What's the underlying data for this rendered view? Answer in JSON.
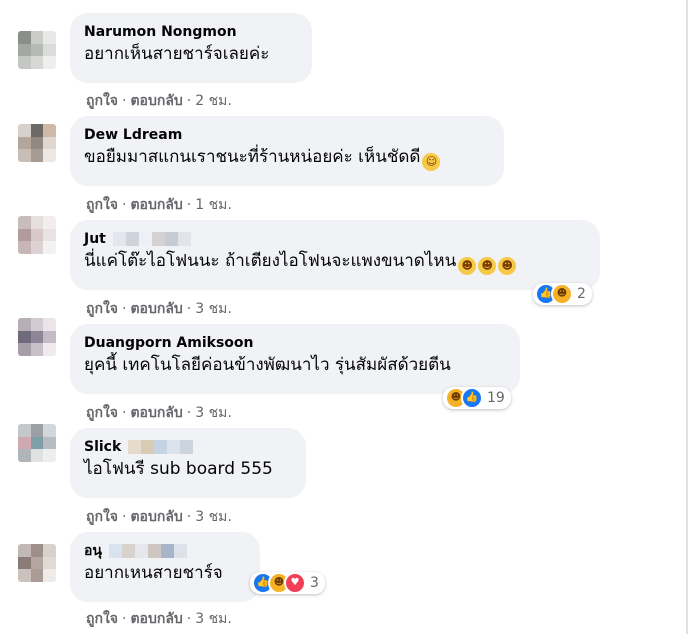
{
  "colors": {
    "bubble_bg": "#f0f2f5",
    "action_text": "#65676b",
    "like_blue": "#1877f2",
    "haha_yellow": "#f7b125"
  },
  "comments": [
    {
      "author": "Narumon Nongmon",
      "text": "อยากเห็นสายชาร์จเลยค่ะ",
      "emoji": "",
      "like": "ถูกใจ",
      "reply": "ตอบกลับ",
      "time": "2 ชม.",
      "reactions": null
    },
    {
      "author": "Dew Ldream",
      "text": "ขอยืมมาสแกนเราชนะที่ร้านหน่อยค่ะ เห็นชัดดี",
      "emoji": "smiling-face",
      "like": "ถูกใจ",
      "reply": "ตอบกลับ",
      "time": "1 ชม.",
      "reactions": null
    },
    {
      "author": "Jut",
      "text": "นี่แค่โต๊ะไอโฟนนะ ถ้าเตียงไอโฟนจะแพงขนาดไหน",
      "emoji": "rofl x3",
      "like": "ถูกใจ",
      "reply": "ตอบกลับ",
      "time": "3 ชม.",
      "reactions": {
        "icons": [
          "like",
          "haha"
        ],
        "count": "2"
      }
    },
    {
      "author": "Duangporn Amiksoon",
      "text": "ยุคนี้ เทคโนโลยีค่อนข้างพัฒนาไว รุ่นสัมผัสด้วยตีน",
      "emoji": "",
      "like": "ถูกใจ",
      "reply": "ตอบกลับ",
      "time": "3 ชม.",
      "reactions": {
        "icons": [
          "haha",
          "like"
        ],
        "count": "19"
      }
    },
    {
      "author": "Slick",
      "text": "ไอโฟนรี sub board 555",
      "emoji": "",
      "like": "ถูกใจ",
      "reply": "ตอบกลับ",
      "time": "3 ชม.",
      "reactions": null
    },
    {
      "author": "อนุ",
      "text": "อยากเหนสายชาร์จ",
      "emoji": "",
      "like": "ถูกใจ",
      "reply": "ตอบกลับ",
      "time": "3 ชม.",
      "reactions": {
        "icons": [
          "like",
          "haha",
          "love"
        ],
        "count": "3"
      }
    }
  ]
}
